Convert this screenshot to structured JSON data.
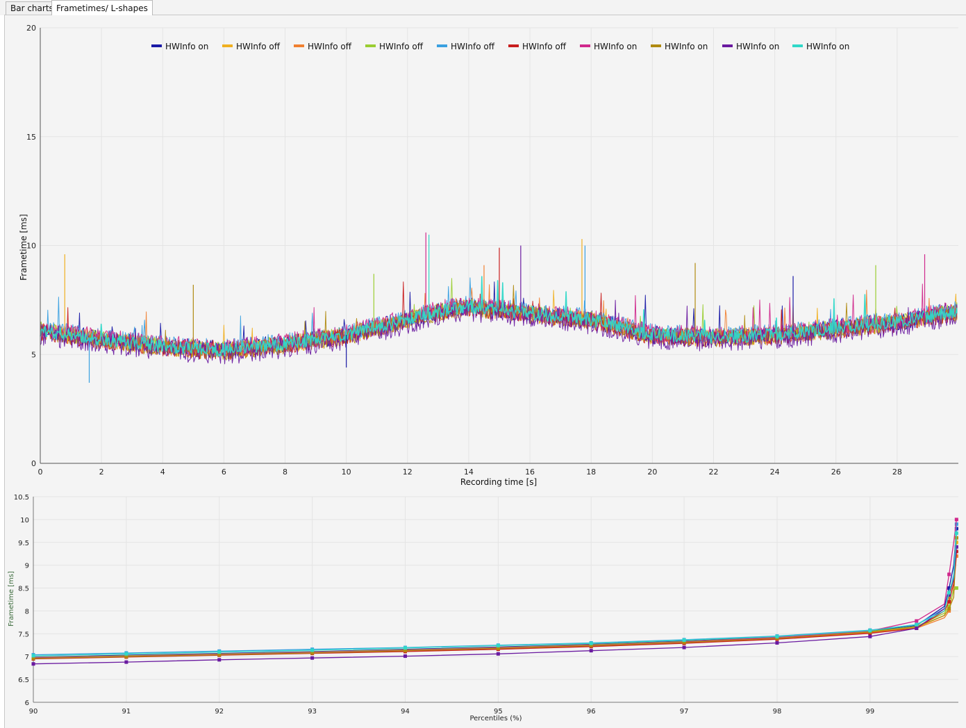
{
  "tabs": [
    {
      "label": "Bar charts",
      "active": false
    },
    {
      "label": "Frametimes/ L-shapes",
      "active": true
    }
  ],
  "colors": {
    "series": [
      "#1a1aa6",
      "#f0b020",
      "#f08030",
      "#9acd32",
      "#3aa0e0",
      "#c81e1e",
      "#d0288c",
      "#b08a10",
      "#6a1aa0",
      "#30d8c8"
    ],
    "grid": "#e4e4e4",
    "panel_bg": "#f4f4f4"
  },
  "chart_data": [
    {
      "type": "line",
      "title": "",
      "xlabel": "Recording time [s]",
      "ylabel": "Frametime [ms]",
      "xlim": [
        0,
        30
      ],
      "ylim": [
        0,
        20
      ],
      "xticks": [
        0,
        2,
        4,
        6,
        8,
        10,
        12,
        14,
        16,
        18,
        20,
        22,
        24,
        26,
        28
      ],
      "yticks": [
        0,
        5,
        10,
        15,
        20
      ],
      "grid": true,
      "legend_position": "top-center",
      "series": [
        {
          "name": "HWInfo on"
        },
        {
          "name": "HWInfo off"
        },
        {
          "name": "HWInfo off"
        },
        {
          "name": "HWInfo off"
        },
        {
          "name": "HWInfo off"
        },
        {
          "name": "HWInfo off"
        },
        {
          "name": "HWInfo on"
        },
        {
          "name": "HWInfo on"
        },
        {
          "name": "HWInfo on"
        },
        {
          "name": "HWInfo on"
        }
      ],
      "trend": {
        "x": [
          0,
          2,
          4,
          6,
          8,
          10,
          12,
          13,
          14,
          16,
          18,
          20,
          22,
          24,
          26,
          28,
          30
        ],
        "y": [
          6.1,
          5.7,
          5.4,
          5.2,
          5.5,
          5.9,
          6.6,
          7.0,
          7.2,
          6.9,
          6.6,
          5.9,
          5.8,
          5.9,
          6.2,
          6.5,
          7.0
        ]
      },
      "spikes": [
        {
          "x": 0.8,
          "y": 9.6
        },
        {
          "x": 1.6,
          "y": 3.7
        },
        {
          "x": 5.0,
          "y": 8.2
        },
        {
          "x": 10.0,
          "y": 4.4
        },
        {
          "x": 10.9,
          "y": 8.7
        },
        {
          "x": 12.6,
          "y": 10.6
        },
        {
          "x": 12.7,
          "y": 10.5
        },
        {
          "x": 14.5,
          "y": 9.1
        },
        {
          "x": 15.0,
          "y": 9.9
        },
        {
          "x": 15.7,
          "y": 10.0
        },
        {
          "x": 17.7,
          "y": 10.3
        },
        {
          "x": 17.8,
          "y": 10.0
        },
        {
          "x": 21.4,
          "y": 9.2
        },
        {
          "x": 24.6,
          "y": 8.6
        },
        {
          "x": 27.3,
          "y": 9.1
        },
        {
          "x": 28.9,
          "y": 9.6
        }
      ]
    },
    {
      "type": "line",
      "title": "",
      "xlabel": "Percentiles (%)",
      "ylabel": "Frametime [ms]",
      "xlim": [
        90,
        99.95
      ],
      "ylim": [
        6,
        10.5
      ],
      "xticks": [
        90,
        91,
        92,
        93,
        94,
        95,
        96,
        97,
        98,
        99
      ],
      "yticks": [
        6,
        6.5,
        7,
        7.5,
        8,
        8.5,
        9,
        9.5,
        10,
        10.5
      ],
      "grid": true,
      "x": [
        90,
        91,
        92,
        93,
        94,
        95,
        96,
        97,
        98,
        99,
        99.5,
        99.8,
        99.85,
        99.9,
        99.93,
        99.95
      ],
      "series": [
        {
          "name": "HWInfo on",
          "values": [
            6.99,
            7.03,
            7.07,
            7.11,
            7.16,
            7.21,
            7.27,
            7.34,
            7.43,
            7.56,
            7.68,
            8.1,
            8.5,
            9.0,
            9.8,
            9.8
          ]
        },
        {
          "name": "HWInfo off",
          "values": [
            6.97,
            7.01,
            7.05,
            7.09,
            7.14,
            7.19,
            7.25,
            7.31,
            7.4,
            7.53,
            7.63,
            7.9,
            8.3,
            8.7,
            9.5,
            9.5
          ]
        },
        {
          "name": "HWInfo off",
          "values": [
            6.96,
            7.0,
            7.04,
            7.08,
            7.12,
            7.17,
            7.23,
            7.3,
            7.39,
            7.52,
            7.62,
            7.85,
            8.0,
            8.5,
            9.2,
            9.2
          ]
        },
        {
          "name": "HWInfo off",
          "values": [
            6.98,
            7.02,
            7.06,
            7.1,
            7.15,
            7.2,
            7.26,
            7.33,
            7.42,
            7.55,
            7.66,
            7.95,
            8.1,
            8.45,
            8.5,
            8.5
          ]
        },
        {
          "name": "HWInfo off",
          "values": [
            7.04,
            7.08,
            7.12,
            7.16,
            7.2,
            7.25,
            7.3,
            7.37,
            7.45,
            7.58,
            7.7,
            8.05,
            8.35,
            8.8,
            9.9,
            9.9
          ]
        },
        {
          "name": "HWInfo off",
          "values": [
            6.95,
            6.99,
            7.03,
            7.07,
            7.11,
            7.16,
            7.22,
            7.29,
            7.38,
            7.51,
            7.62,
            8.0,
            8.2,
            8.6,
            9.3,
            9.3
          ]
        },
        {
          "name": "HWInfo on",
          "values": [
            6.97,
            7.01,
            7.05,
            7.09,
            7.14,
            7.19,
            7.25,
            7.32,
            7.42,
            7.56,
            7.78,
            8.15,
            8.8,
            9.5,
            10.0,
            10.0
          ]
        },
        {
          "name": "HWInfo on",
          "values": [
            6.96,
            7.0,
            7.04,
            7.08,
            7.13,
            7.18,
            7.24,
            7.31,
            7.4,
            7.54,
            7.65,
            7.9,
            8.05,
            8.3,
            9.6,
            9.6
          ]
        },
        {
          "name": "HWInfo on",
          "values": [
            6.84,
            6.88,
            6.93,
            6.97,
            7.01,
            7.06,
            7.13,
            7.2,
            7.3,
            7.44,
            7.62,
            8.05,
            8.35,
            8.7,
            9.4,
            9.4
          ]
        },
        {
          "name": "HWInfo on",
          "values": [
            7.02,
            7.06,
            7.1,
            7.14,
            7.19,
            7.24,
            7.29,
            7.36,
            7.44,
            7.57,
            7.7,
            8.0,
            8.4,
            8.75,
            9.7,
            9.7
          ]
        }
      ]
    }
  ]
}
